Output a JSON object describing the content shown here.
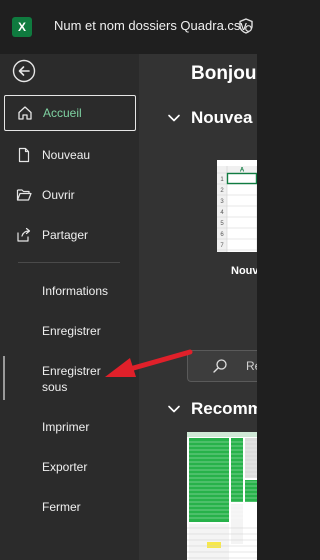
{
  "window": {
    "app_logo_letter": "X",
    "title": "Num et nom dossiers Quadra.csv"
  },
  "sidebar": {
    "primary_items": [
      {
        "label": "Accueil",
        "icon": "home-icon",
        "active": true
      },
      {
        "label": "Nouveau",
        "icon": "new-document-icon",
        "active": false
      },
      {
        "label": "Ouvrir",
        "icon": "folder-open-icon",
        "active": false
      },
      {
        "label": "Partager",
        "icon": "share-icon",
        "active": false
      }
    ],
    "secondary_items": [
      {
        "label": "Informations"
      },
      {
        "label": "Enregistrer"
      },
      {
        "label": "Enregistrer sous",
        "line1": "Enregistrer",
        "line2": "sous"
      },
      {
        "label": "Imprimer"
      },
      {
        "label": "Exporter"
      },
      {
        "label": "Fermer"
      }
    ]
  },
  "main": {
    "greeting": "Bonjou",
    "new_section_title": "Nouvea",
    "template_label": "Nouv",
    "search_placeholder": "Re",
    "recommended_section_title": "Recomm",
    "template_grid": {
      "column_header": "A",
      "row_numbers": [
        "1",
        "2",
        "3",
        "4",
        "5",
        "6",
        "7"
      ]
    }
  },
  "colors": {
    "accent": "#3fb36a",
    "annotation_arrow": "#e0202a",
    "excel_green": "#0f7b3f"
  }
}
